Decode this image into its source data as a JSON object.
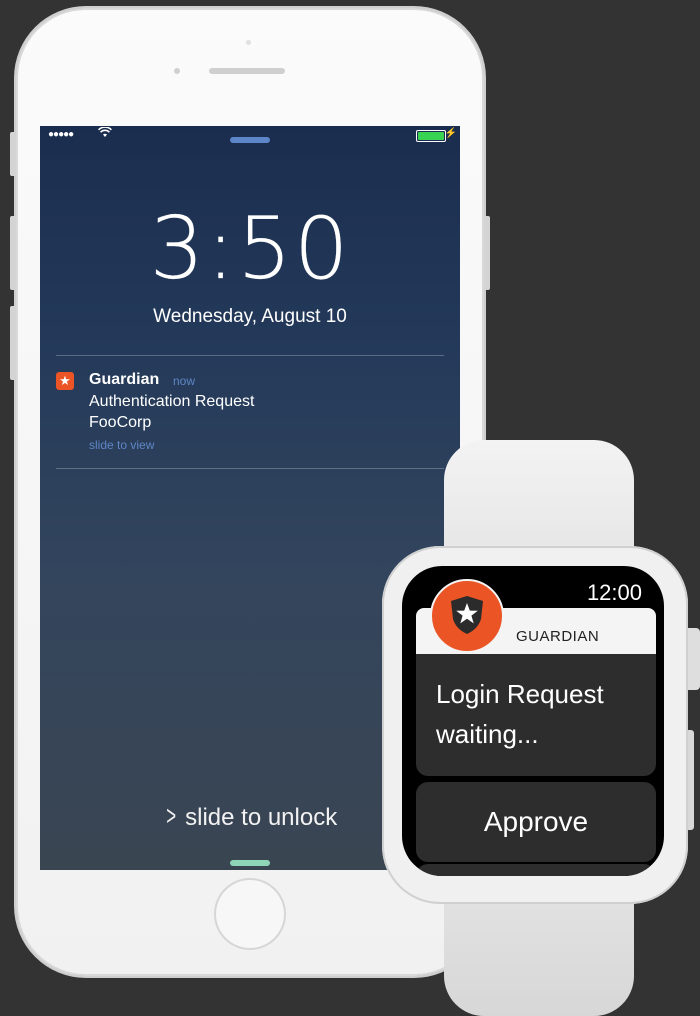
{
  "phone": {
    "status": {
      "signal": "●●●●●",
      "wifi_icon": "wifi-icon",
      "battery_level": 1.0,
      "battery_color": "#39d353"
    },
    "lock_time": "3:50",
    "lock_date": "Wednesday, August 10",
    "notification": {
      "app": "Guardian",
      "time": "now",
      "title": "Authentication Request",
      "subtitle": "FooCorp",
      "action": "slide to view",
      "icon_color": "#eb5424"
    },
    "unlock_text": "slide to unlock"
  },
  "watch": {
    "time": "12:00",
    "app_name": "GUARDIAN",
    "message": "Login Request waiting...",
    "approve_label": "Approve",
    "logo_color": "#eb5424"
  },
  "colors": {
    "background": "#333333",
    "accent": "#eb5424",
    "link": "#5f86c6"
  }
}
